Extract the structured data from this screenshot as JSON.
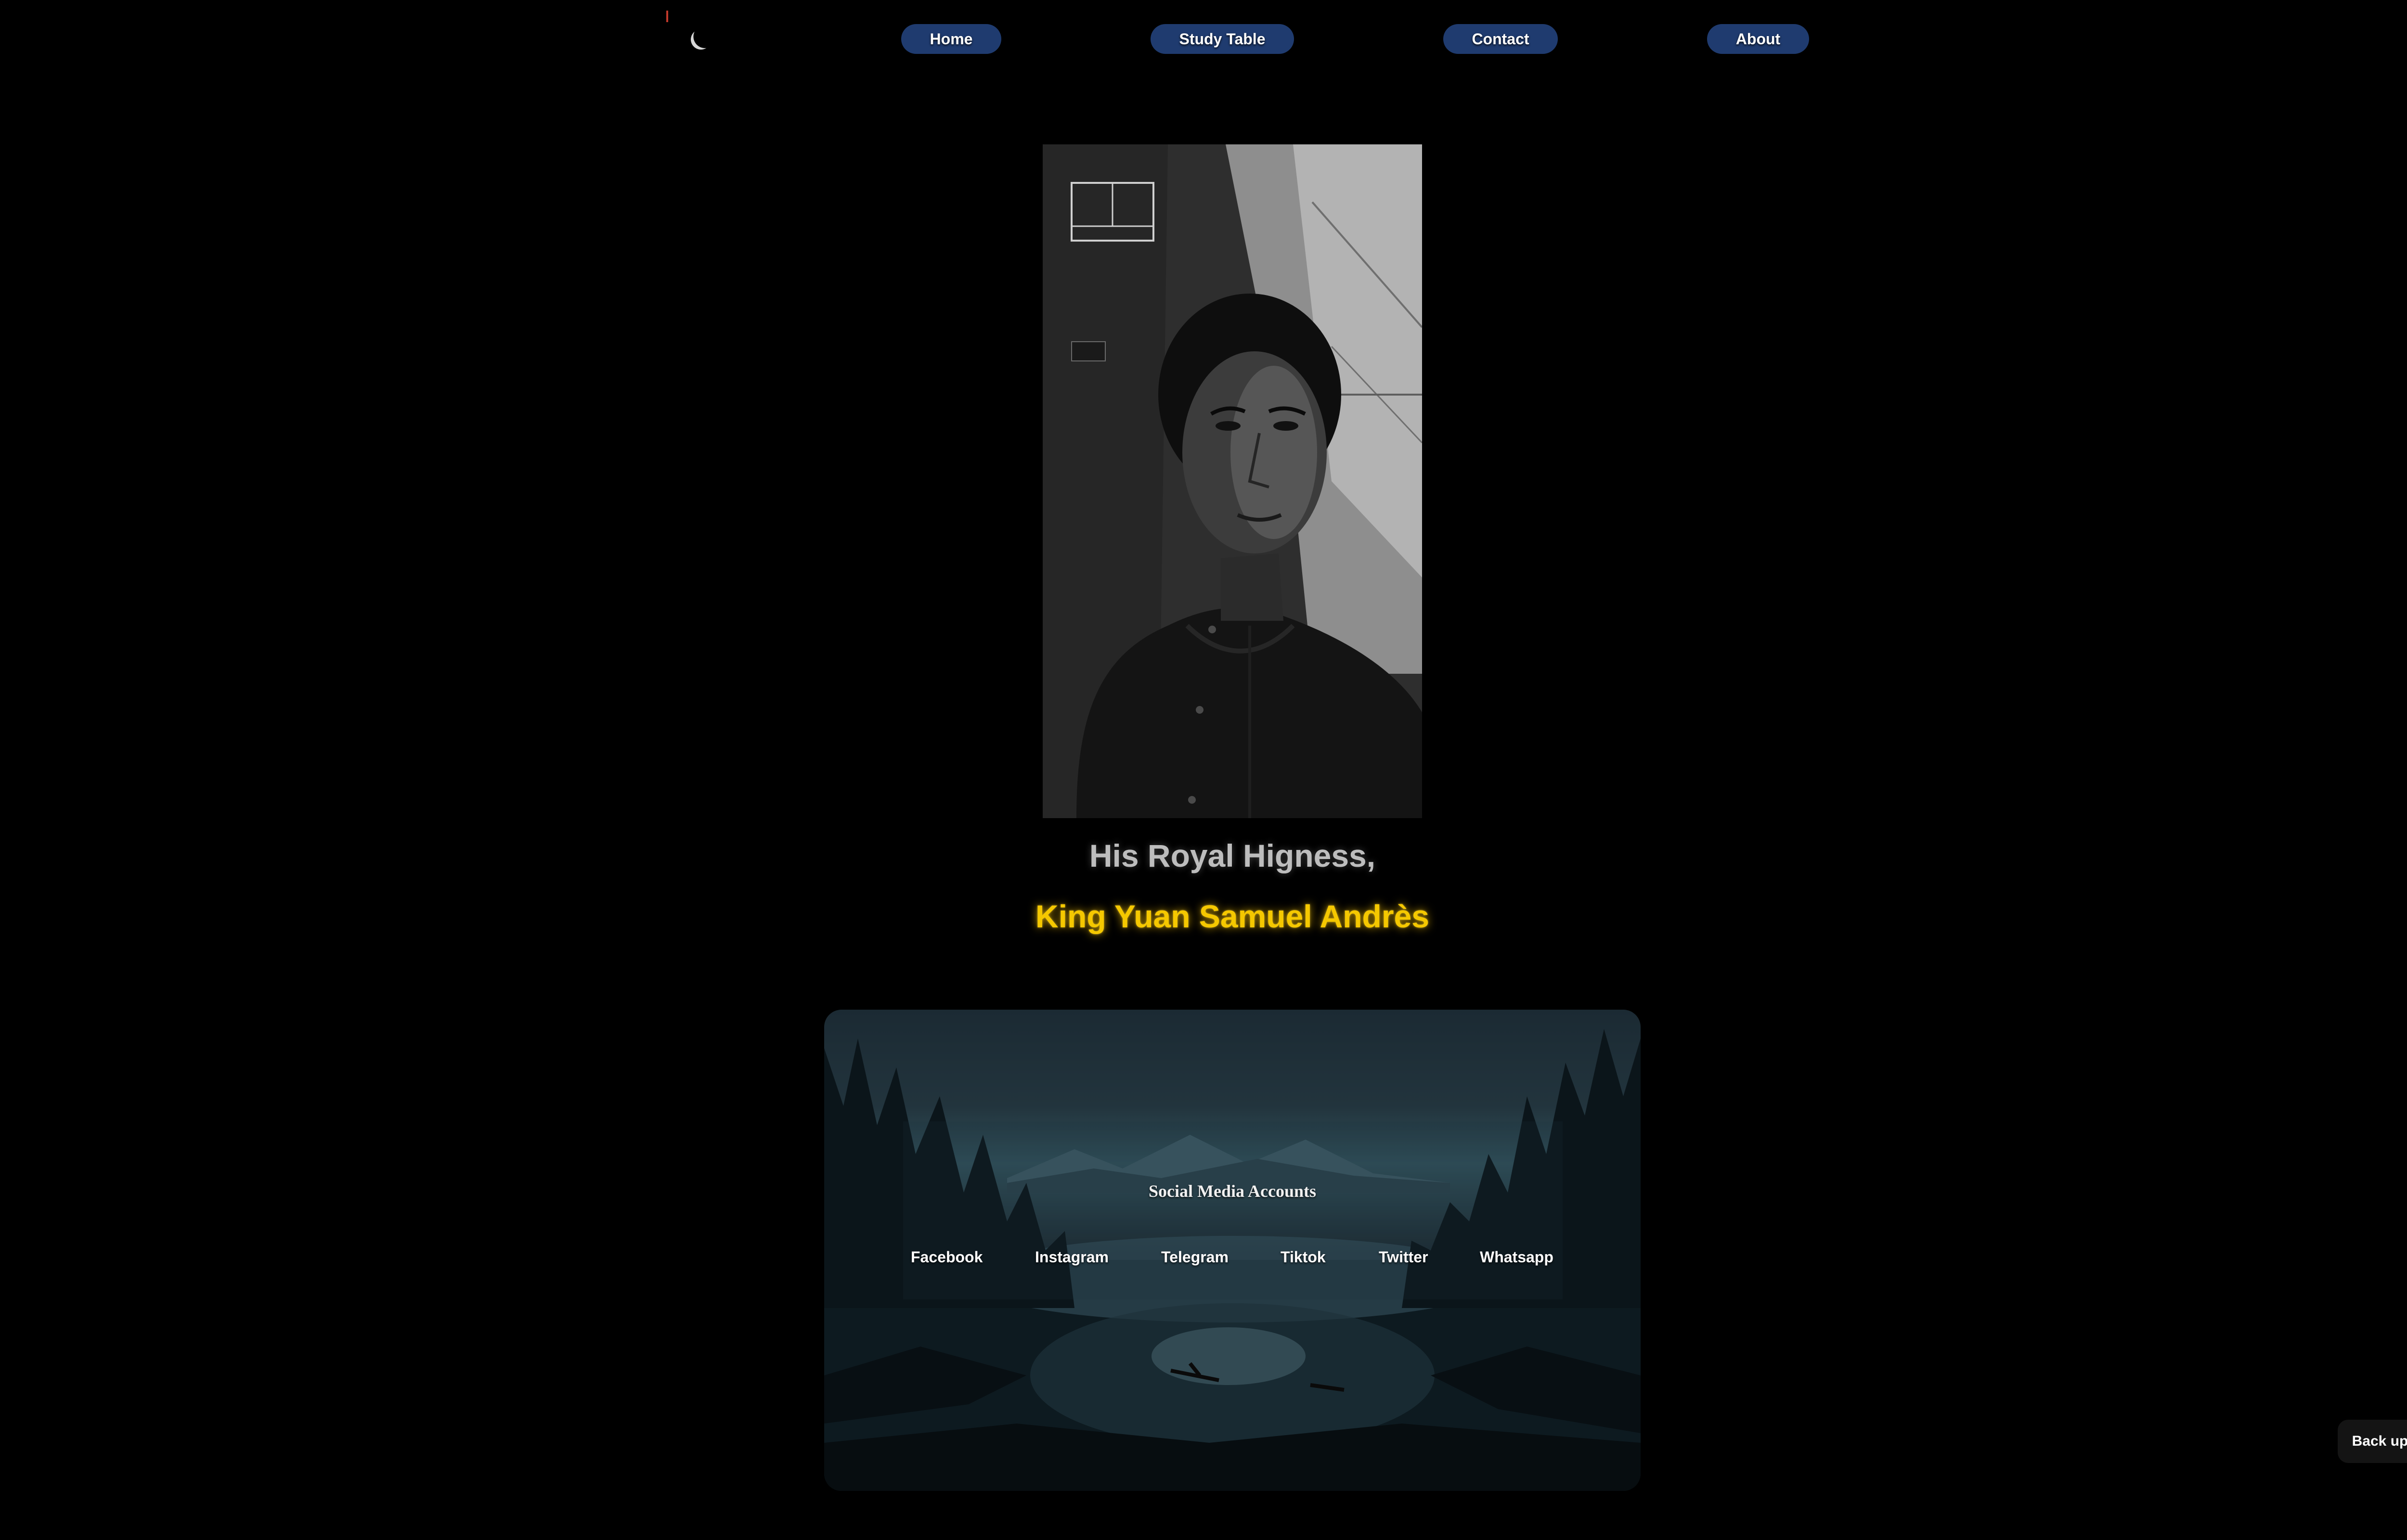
{
  "nav": {
    "items": [
      {
        "label": "Home"
      },
      {
        "label": "Study Table"
      },
      {
        "label": "Contact"
      },
      {
        "label": "About"
      }
    ]
  },
  "profile": {
    "honorific": "His Royal Higness,",
    "name": "King Yuan Samuel Andrès"
  },
  "social": {
    "heading": "Social Media Accounts",
    "links": [
      {
        "label": "Facebook"
      },
      {
        "label": "Instagram"
      },
      {
        "label": "Telegram"
      },
      {
        "label": "Tiktok"
      },
      {
        "label": "Twitter"
      },
      {
        "label": "Whatsapp"
      }
    ]
  },
  "footer": {
    "back_up_label": "Back up"
  },
  "colors": {
    "background": "#000000",
    "nav_button": "#1f3b6f",
    "name_gold": "#f5c800",
    "honorific_gray": "#bdbdbd"
  }
}
